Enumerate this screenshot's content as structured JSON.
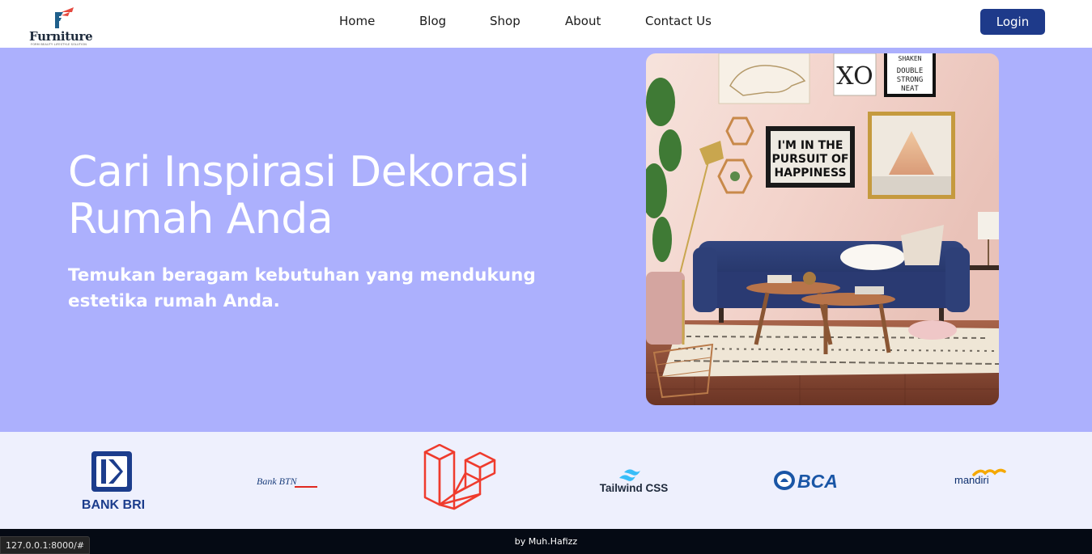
{
  "brand": {
    "name": "Furniture",
    "tagline": "FORM BEAUTY LIFESTYLE SOLUTION",
    "colors": {
      "mark_blue": "#1f5f8b",
      "mark_red": "#e5493f",
      "text": "#1e2b3c"
    }
  },
  "nav": {
    "items": [
      {
        "label": "Home"
      },
      {
        "label": "Blog"
      },
      {
        "label": "Shop"
      },
      {
        "label": "About"
      },
      {
        "label": "Contact Us"
      }
    ],
    "login_label": "Login"
  },
  "hero": {
    "title": "Cari Inspirasi Dekorasi Rumah Anda",
    "subtitle": "Temukan beragam kebutuhan yang mendukung estetika rumah Anda.",
    "background": "#acb0fd",
    "photo": {
      "posters": {
        "xo": "XO",
        "shaken_lines": [
          "SHAKEN",
          "DOUBLE",
          "STRONG",
          "NEAT"
        ],
        "happiness_lines": [
          "I'M IN THE",
          "PURSUIT OF",
          "HAPPINESS"
        ]
      }
    }
  },
  "partners": [
    {
      "name": "BANK BRI",
      "icon": "bri-logo-icon"
    },
    {
      "name": "Bank BTN",
      "icon": "btn-logo-icon"
    },
    {
      "name": "Laravel",
      "icon": "laravel-logo-icon"
    },
    {
      "name": "Tailwind CSS",
      "icon": "tailwind-logo-icon"
    },
    {
      "name": "BCA",
      "icon": "bca-logo-icon"
    },
    {
      "name": "mandiri",
      "icon": "mandiri-logo-icon"
    }
  ],
  "footer": {
    "credit": "by Muh.Hafizz"
  },
  "status_bar": {
    "url": "127.0.0.1:8000/#"
  },
  "accent": "#1e3a8a"
}
